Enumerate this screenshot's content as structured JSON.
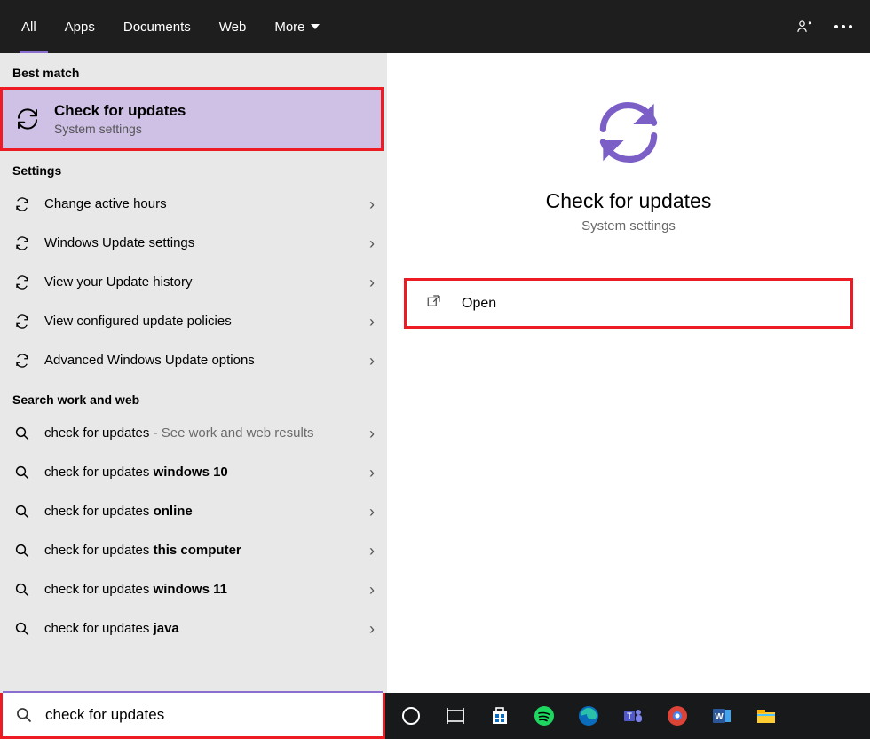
{
  "topbar": {
    "tabs": [
      "All",
      "Apps",
      "Documents",
      "Web",
      "More"
    ]
  },
  "sections": {
    "best_match": "Best match",
    "settings": "Settings",
    "search_work_web": "Search work and web"
  },
  "best_match_item": {
    "title": "Check for updates",
    "subtitle": "System settings"
  },
  "settings_items": [
    {
      "label": "Change active hours"
    },
    {
      "label": "Windows Update settings"
    },
    {
      "label": "View your Update history"
    },
    {
      "label": "View configured update policies"
    },
    {
      "label": "Advanced Windows Update options"
    }
  ],
  "web_items": [
    {
      "prefix": "check for updates",
      "suffix": " - See work and web results"
    },
    {
      "prefix": "check for updates ",
      "bold": "windows 10"
    },
    {
      "prefix": "check for updates ",
      "bold": "online"
    },
    {
      "prefix": "check for updates ",
      "bold": "this computer"
    },
    {
      "prefix": "check for updates ",
      "bold": "windows 11"
    },
    {
      "prefix": "check for updates ",
      "bold": "java"
    }
  ],
  "detail": {
    "title": "Check for updates",
    "subtitle": "System settings",
    "open_label": "Open"
  },
  "search_value": "check for updates"
}
